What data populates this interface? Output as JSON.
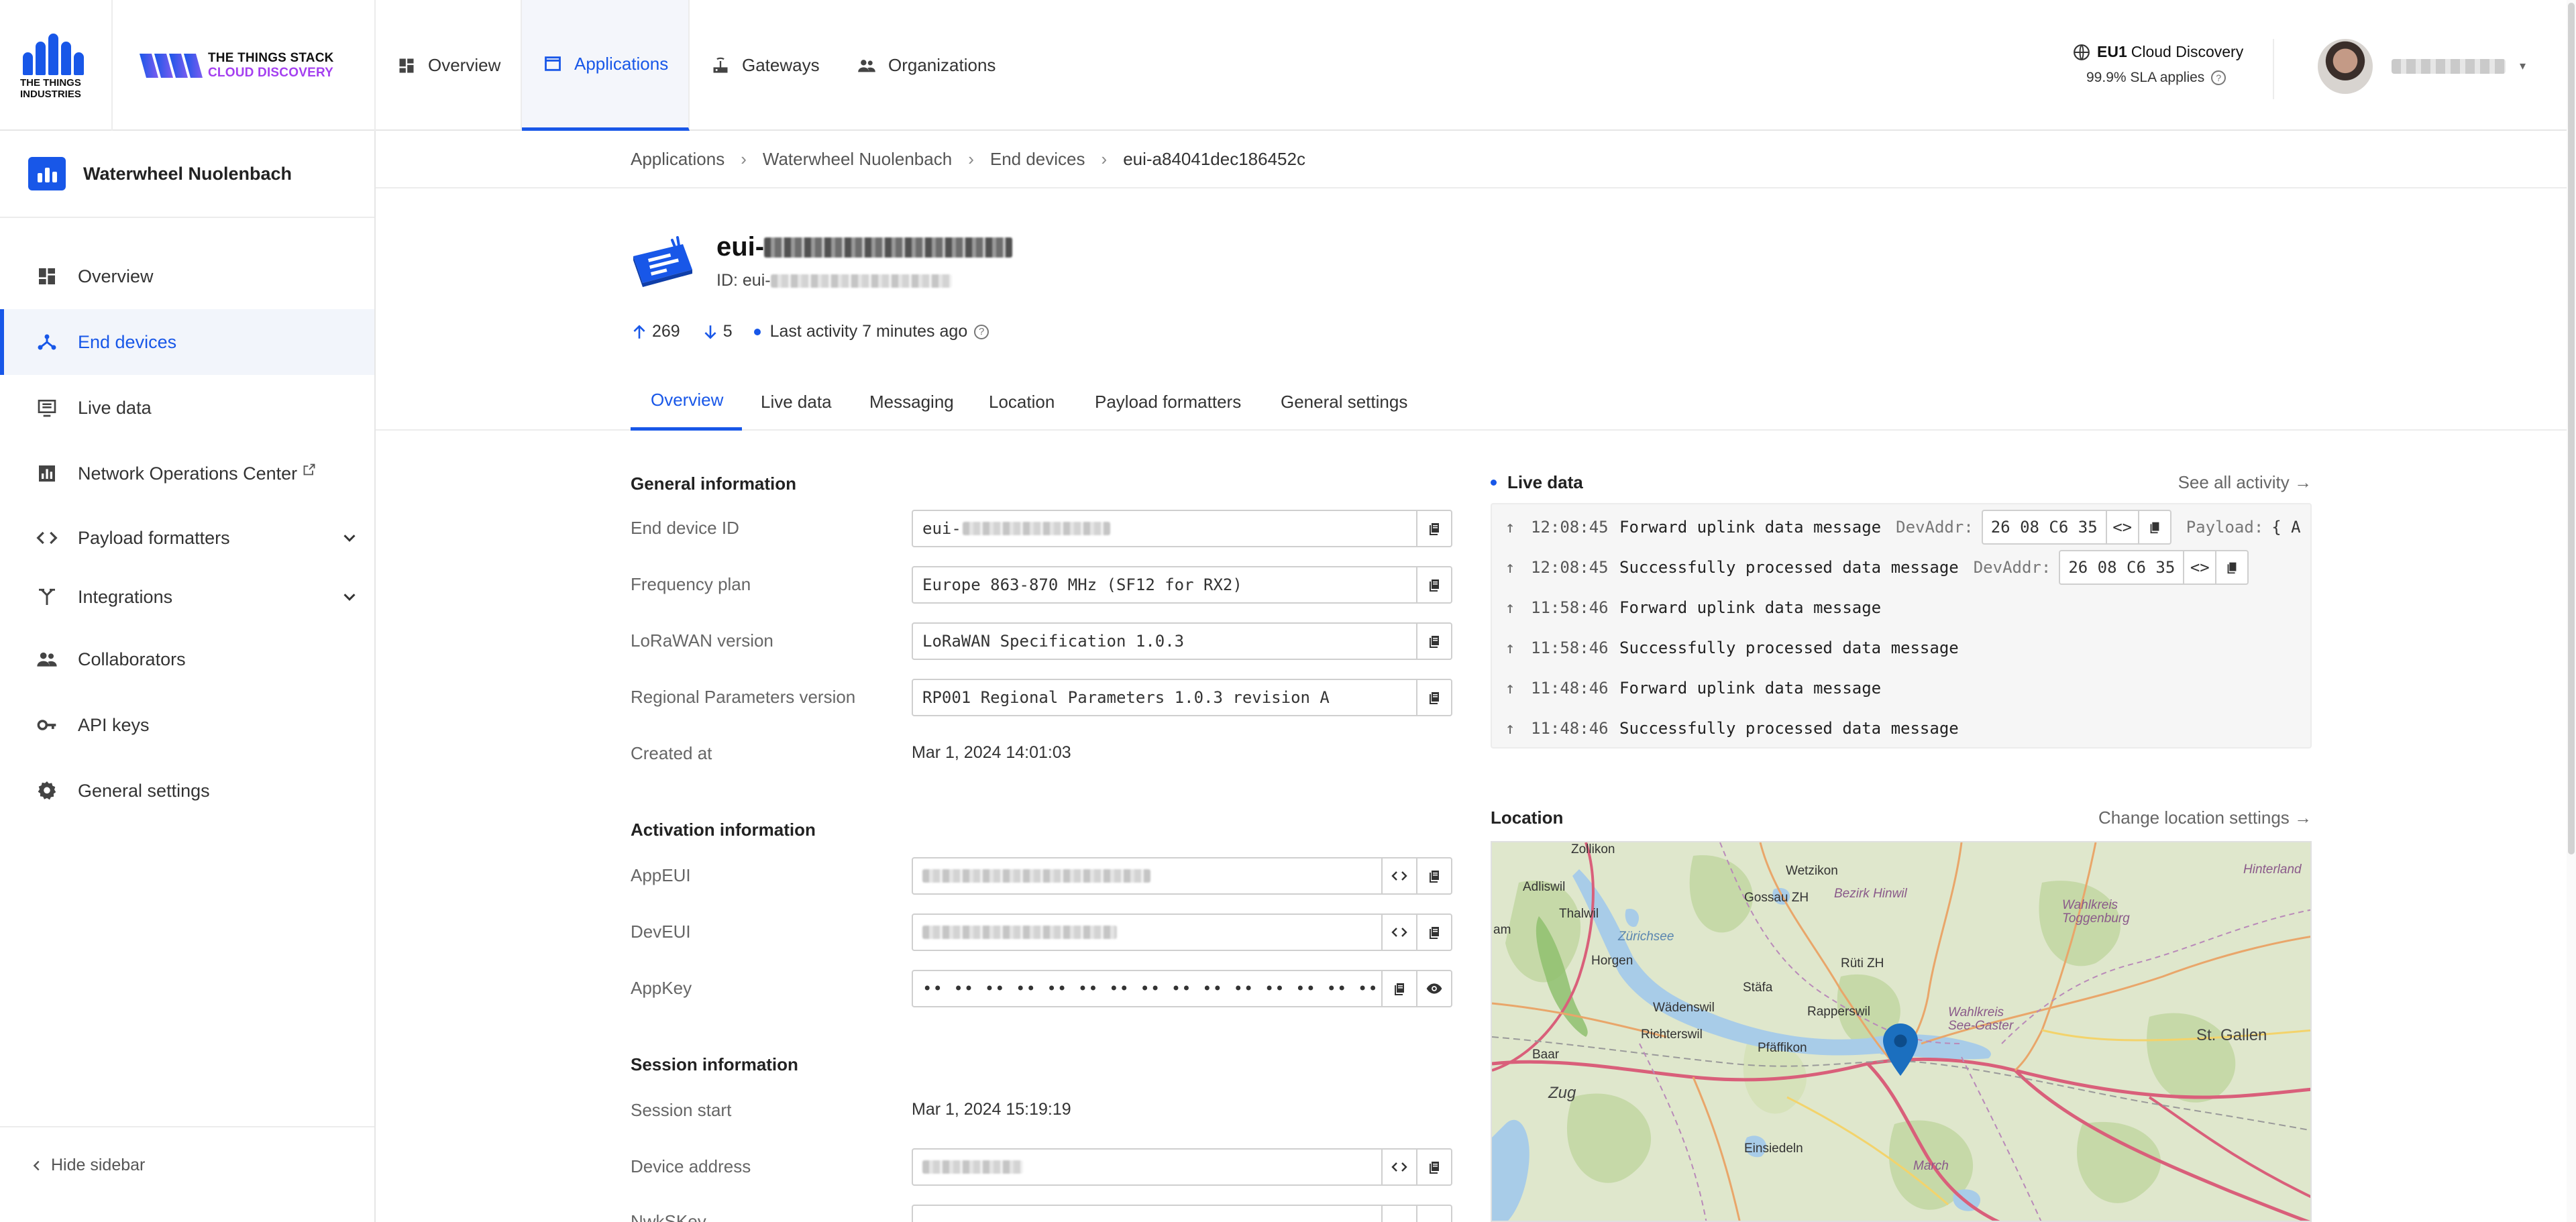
{
  "header": {
    "company_name": "THE THINGS INDUSTRIES",
    "product_line1": "THE THINGS STACK",
    "product_line2": "CLOUD DISCOVERY",
    "nav": {
      "overview": "Overview",
      "applications": "Applications",
      "gateways": "Gateways",
      "organizations": "Organizations"
    },
    "cluster_id": "EU1",
    "cluster_name": "Cloud Discovery",
    "sla": "99.9% SLA applies",
    "accent_color": "#1857e8",
    "brand_purple": "#a43ff0"
  },
  "sidebar": {
    "app_name": "Waterwheel Nuolenbach",
    "items": [
      {
        "label": "Overview",
        "icon": "dashboard-icon"
      },
      {
        "label": "End devices",
        "icon": "end-devices-icon"
      },
      {
        "label": "Live data",
        "icon": "list-icon"
      },
      {
        "label": "Network Operations Center",
        "icon": "chart-icon"
      },
      {
        "label": "Payload formatters",
        "icon": "code-icon"
      },
      {
        "label": "Integrations",
        "icon": "integrations-icon"
      },
      {
        "label": "Collaborators",
        "icon": "people-icon"
      },
      {
        "label": "API keys",
        "icon": "key-icon"
      },
      {
        "label": "General settings",
        "icon": "gear-icon"
      }
    ],
    "active_item": "End devices",
    "hide": "Hide sidebar"
  },
  "breadcrumb": [
    "Applications",
    "Waterwheel Nuolenbach",
    "End devices",
    "eui-a84041dec186452c"
  ],
  "device": {
    "title_prefix": "eui-",
    "id_label": "ID:",
    "id_prefix": "eui-",
    "uplinks": "269",
    "downlinks": "5",
    "last_activity": "Last activity 7 minutes ago"
  },
  "tabs": [
    "Overview",
    "Live data",
    "Messaging",
    "Location",
    "Payload formatters",
    "General settings"
  ],
  "active_tab": "Overview",
  "general_information": {
    "title": "General information",
    "end_device_id_label": "End device ID",
    "end_device_id_prefix": "eui-",
    "frequency_plan_label": "Frequency plan",
    "frequency_plan": "Europe 863-870 MHz (SF12 for RX2)",
    "lorawan_version_label": "LoRaWAN version",
    "lorawan_version": "LoRaWAN Specification 1.0.3",
    "regional_params_label": "Regional Parameters version",
    "regional_params": "RP001 Regional Parameters 1.0.3 revision A",
    "created_at_label": "Created at",
    "created_at": "Mar 1, 2024 14:01:03"
  },
  "activation_information": {
    "title": "Activation information",
    "appeui_label": "AppEUI",
    "deveui_label": "DevEUI",
    "appkey_label": "AppKey",
    "appkey_masked": "•• •• •• •• •• •• •• •• •• •• •• •• •• •• •• ••"
  },
  "session_information": {
    "title": "Session information",
    "session_start_label": "Session start",
    "session_start": "Mar 1, 2024 15:19:19",
    "device_address_label": "Device address",
    "nwkskey_label": "NwkSKey"
  },
  "live_data": {
    "title": "Live data",
    "see_all": "See all activity →",
    "rows": [
      {
        "time": "12:08:45",
        "message": "Forward uplink data message",
        "devaddr_label": "DevAddr:",
        "devaddr": "26 08 C6 35",
        "payload_label": "Payload:",
        "payload": "{ A"
      },
      {
        "time": "12:08:45",
        "message": "Successfully processed data message",
        "devaddr_label": "DevAddr:",
        "devaddr": "26 08 C6 35"
      },
      {
        "time": "11:58:46",
        "message": "Forward uplink data message"
      },
      {
        "time": "11:58:46",
        "message": "Successfully processed data message"
      },
      {
        "time": "11:48:46",
        "message": "Forward uplink data message"
      },
      {
        "time": "11:48:46",
        "message": "Successfully processed data message"
      }
    ]
  },
  "location": {
    "title": "Location",
    "change": "Change location settings →",
    "map_labels": {
      "zollikon": "Zollikon",
      "adliswil": "Adliswil",
      "thalwil": "Thalwil",
      "am": "am",
      "horgen": "Horgen",
      "wadenswil": "Wädenswil",
      "richterswil": "Richterswil",
      "baar": "Baar",
      "zug": "Zug",
      "wetzikon": "Wetzikon",
      "gossau": "Gossau ZH",
      "hinwil": "Bezirk Hinwil",
      "zurichsee": "Zürichsee",
      "stafa": "Stäfa",
      "ruti": "Rüti ZH",
      "rapperswil": "Rapperswil",
      "pfaffikon": "Pfäffikon",
      "wahlkreis_see": "Wahlkreis See-Gaster",
      "wahlkreis_toggenburg": "Wahlkreis Toggenburg",
      "hinterland": "Hinterland",
      "st_gallen": "St. Gallen",
      "einsiedeln": "Einsiedeln",
      "march": "March"
    }
  }
}
